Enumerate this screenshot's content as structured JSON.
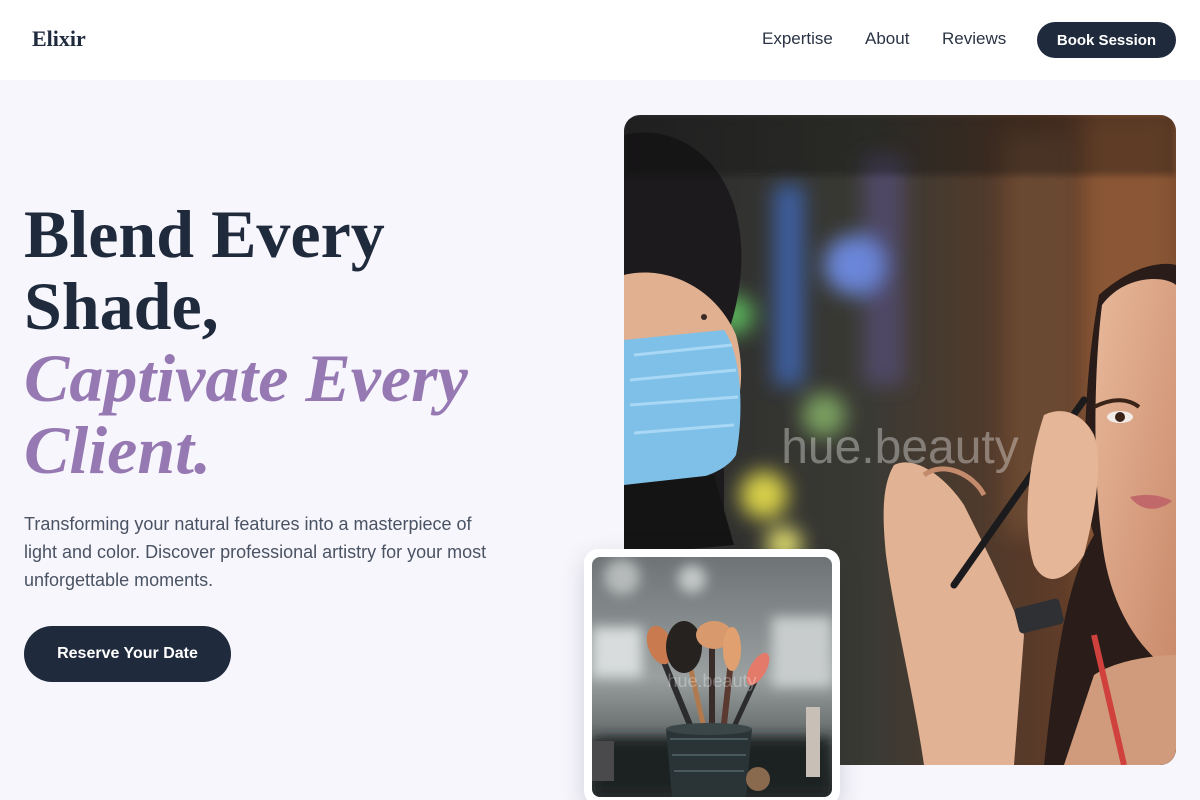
{
  "header": {
    "logo": "Elixir",
    "nav": [
      "Expertise",
      "About",
      "Reviews"
    ],
    "cta_label": "Book Session"
  },
  "hero": {
    "title_lines": [
      "Blend Every",
      "Shade,"
    ],
    "title_accent_lines": [
      "Captivate Every",
      "Client."
    ],
    "description": "Transforming your natural features into a masterpiece of light and color. Discover professional artistry for your most unforgettable moments.",
    "cta_label": "Reserve Your Date"
  },
  "images": {
    "main_watermark": "hue.beauty",
    "thumb_watermark": "hue.beauty"
  },
  "colors": {
    "primary": "#1f2a3d",
    "accent": "#9678b2",
    "background": "#f7f6fc"
  }
}
